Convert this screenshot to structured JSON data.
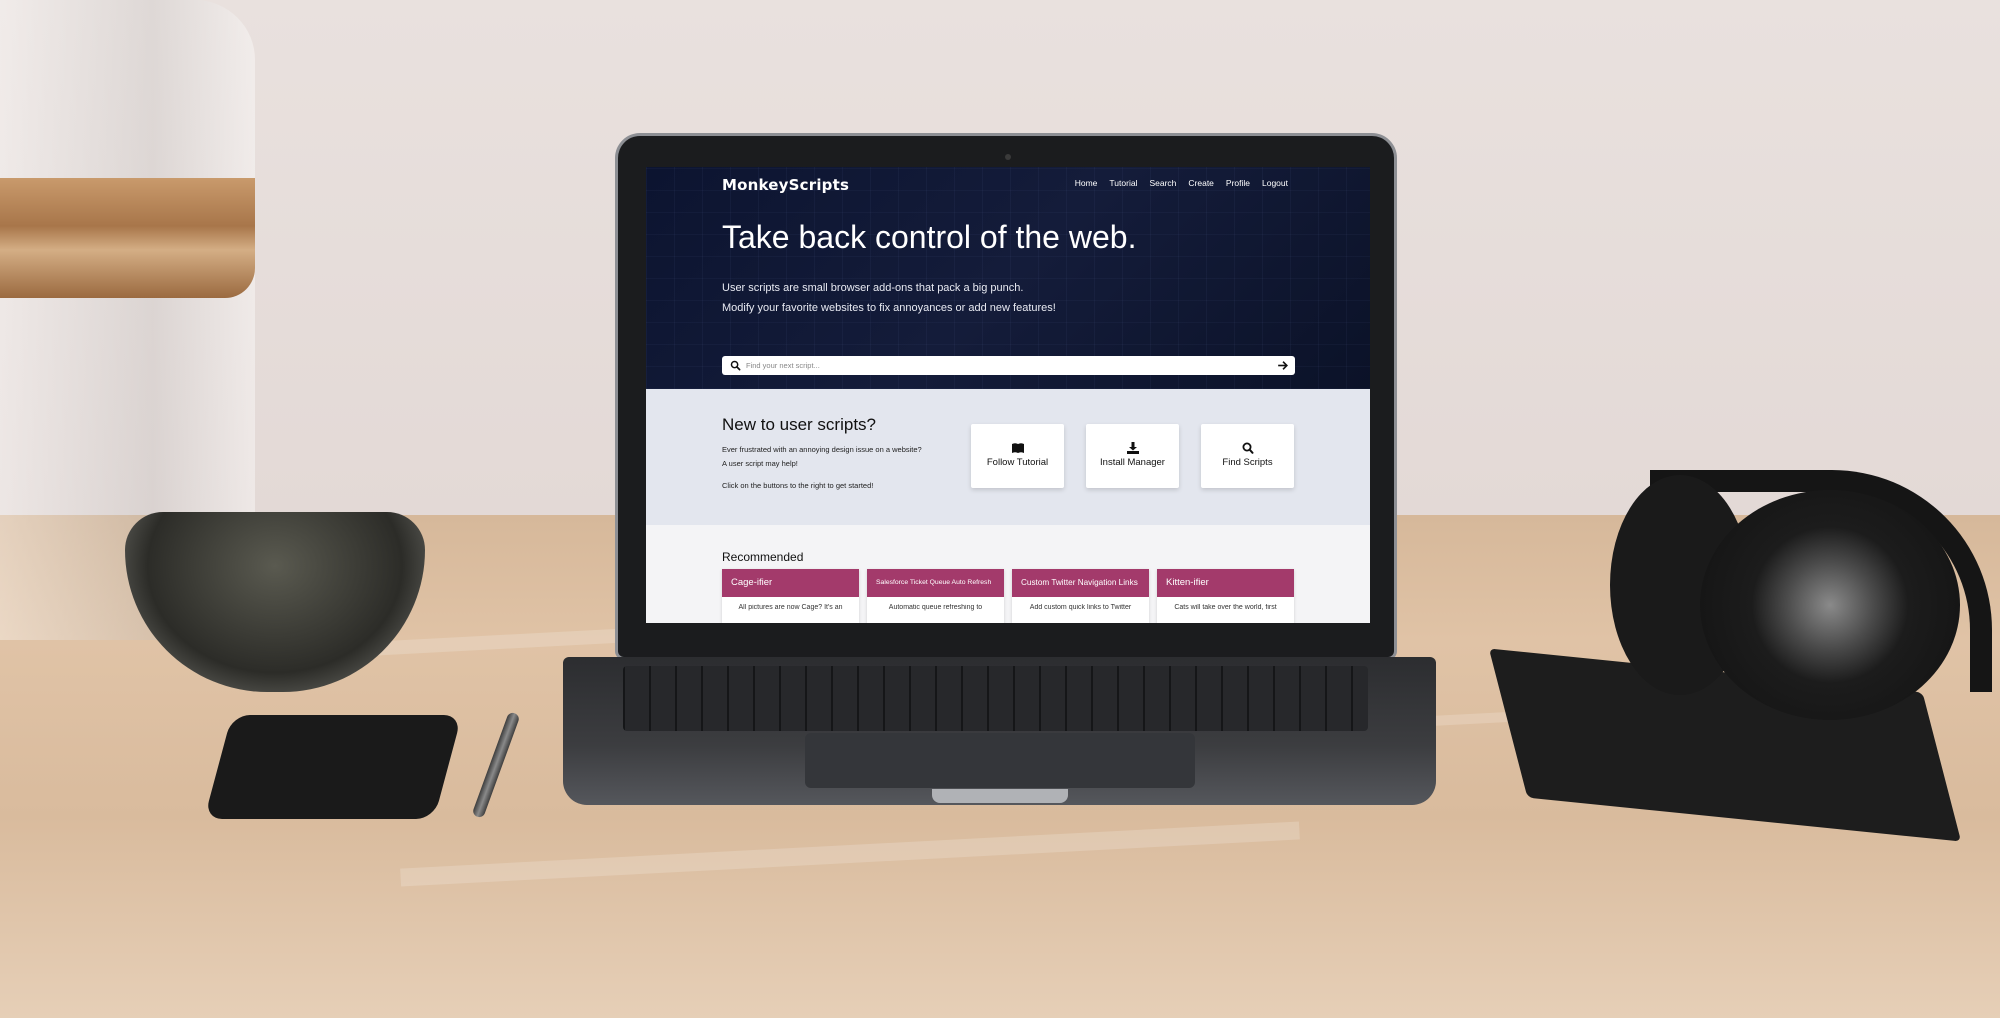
{
  "site": {
    "logo": "MonkeyScripts",
    "nav": [
      "Home",
      "Tutorial",
      "Search",
      "Create",
      "Profile",
      "Logout"
    ]
  },
  "hero": {
    "title": "Take back control of the web.",
    "subtitle_line1": "User scripts are small browser add-ons that pack a big punch.",
    "subtitle_line2": "Modify your favorite websites to fix annoyances or add new features!",
    "search_placeholder": "Find your next script..."
  },
  "intro": {
    "title": "New to user scripts?",
    "line1": "Ever frustrated with an annoying design issue on a website?",
    "line2": "A user script may help!",
    "line3": "Click on the buttons to the right to get started!",
    "buttons": [
      {
        "label": "Follow Tutorial",
        "icon": "book-icon"
      },
      {
        "label": "Install Manager",
        "icon": "download-icon"
      },
      {
        "label": "Find Scripts",
        "icon": "search-icon"
      }
    ]
  },
  "recommended": {
    "title": "Recommended",
    "items": [
      {
        "title": "Cage-ifier",
        "desc": "All pictures are now Cage? It's an"
      },
      {
        "title": "Salesforce Ticket Queue Auto Refresh",
        "desc": "Automatic queue refreshing to"
      },
      {
        "title": "Custom Twitter Navigation Links",
        "desc": "Add custom quick links to Twitter"
      },
      {
        "title": "Kitten-ifier",
        "desc": "Cats will take over the world, first"
      }
    ]
  },
  "colors": {
    "hero_bg": "#0c1430",
    "intro_bg": "#e3e6ee",
    "accent": "#a33a6b"
  }
}
